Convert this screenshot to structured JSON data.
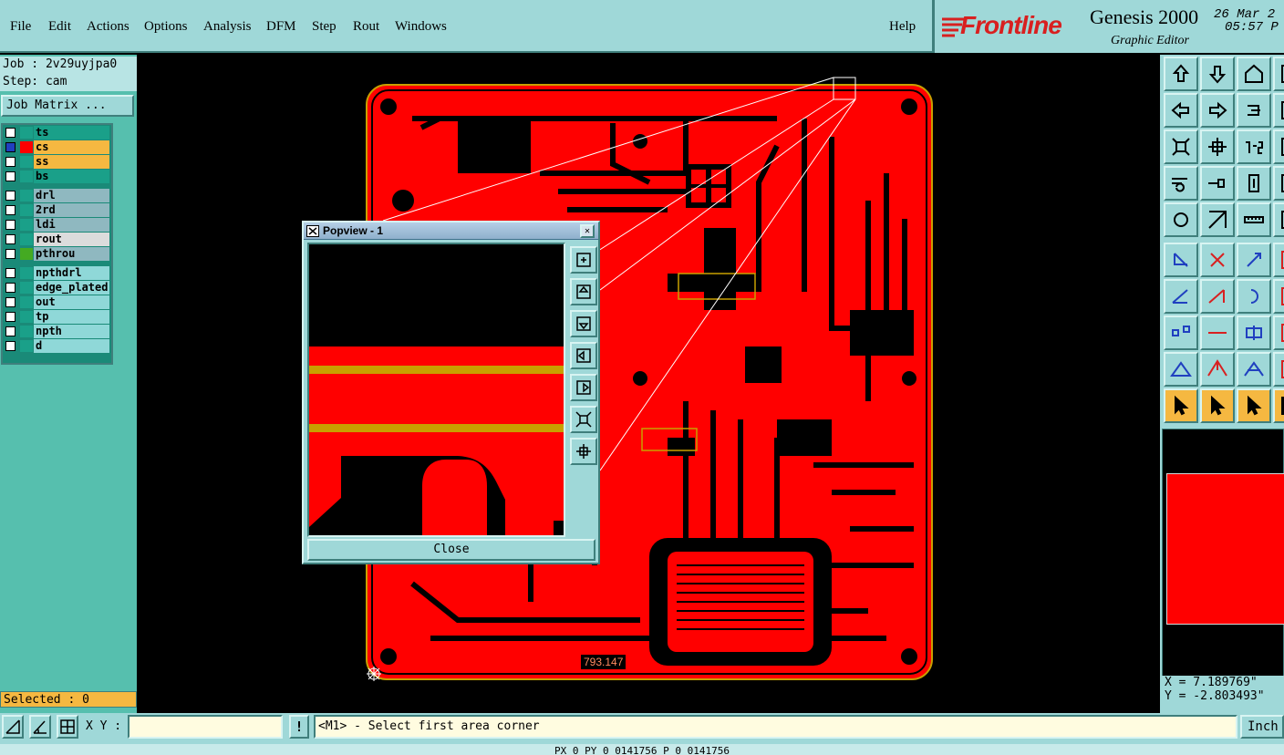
{
  "menu": [
    "File",
    "Edit",
    "Actions",
    "Options",
    "Analysis",
    "DFM",
    "Step",
    "Rout",
    "Windows"
  ],
  "help_label": "Help",
  "brand": {
    "logo_text": "Frontline",
    "app_name": "Genesis 2000",
    "app_sub": "Graphic Editor",
    "date": "26 Mar 2",
    "time": "05:57 P"
  },
  "job": {
    "job_text": "Job : 2v29uyjpa0",
    "step_text": "Step: cam",
    "matrix_button": "Job Matrix ..."
  },
  "layers": [
    {
      "name": "ts",
      "color": "#1aa089",
      "swatch": "#1aa089"
    },
    {
      "name": "cs",
      "color": "#f5b841",
      "swatch": "#ff0000"
    },
    {
      "name": "ss",
      "color": "#f5b841",
      "swatch": "#1aa089"
    },
    {
      "name": "bs",
      "color": "#1aa089",
      "swatch": "#1aa089"
    },
    {
      "name": "drl",
      "color": "#8fb8c0",
      "swatch": "#1aa089"
    },
    {
      "name": "2rd",
      "color": "#8fb8c0",
      "swatch": "#1aa089"
    },
    {
      "name": "ldi",
      "color": "#8fb8c0",
      "swatch": "#1aa089"
    },
    {
      "name": "rout",
      "color": "#dcdcdc",
      "swatch": "#1aa089"
    },
    {
      "name": "pthrou",
      "color": "#8fb8c0",
      "swatch": "#44aa22"
    },
    {
      "name": "npthdrl",
      "color": "#8fd8d8",
      "swatch": "#1aa089"
    },
    {
      "name": "edge_plated",
      "color": "#8fd8d8",
      "swatch": "#1aa089"
    },
    {
      "name": "out",
      "color": "#8fd8d8",
      "swatch": "#1aa089"
    },
    {
      "name": "tp",
      "color": "#8fd8d8",
      "swatch": "#1aa089"
    },
    {
      "name": "npth",
      "color": "#8fd8d8",
      "swatch": "#1aa089"
    },
    {
      "name": "d",
      "color": "#8fd8d8",
      "swatch": "#1aa089"
    }
  ],
  "selected_text": "Selected : 0",
  "popview": {
    "title": "Popview - 1",
    "close_label": "Close",
    "close_x": "✕"
  },
  "board_label": "793.147",
  "coords": {
    "x": "X = 7.189769\"",
    "y": "Y = -2.803493\""
  },
  "statusbar": {
    "xy_label": "X Y :",
    "xy_value": "",
    "warn": "!",
    "message": "<M1> - Select first area corner",
    "units": "Inch"
  },
  "footer_text": "PX 0 PY 0 0141756 P 0 0141756",
  "colors": {
    "panel": "#9fd8d8",
    "accent": "#56bfae",
    "copper": "#ff0000",
    "mask": "#c8a000"
  }
}
